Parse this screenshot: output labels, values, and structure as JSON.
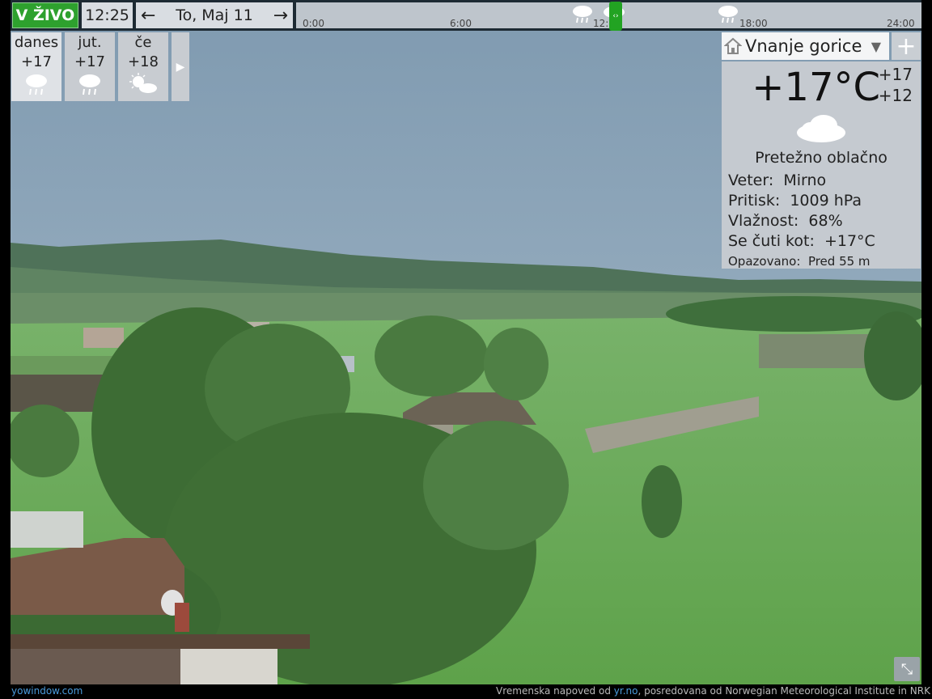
{
  "topbar": {
    "live_label": "V ŽIVO",
    "time": "12:25",
    "date": "To, Maj 11",
    "prev_icon": "arrow-left-icon",
    "next_icon": "arrow-right-icon",
    "timeline_ticks": [
      "0:00",
      "6:00",
      "12:",
      "18:00",
      "24:00"
    ],
    "timeline_position_hours": 12.4
  },
  "forecast": {
    "days": [
      {
        "name": "danes",
        "temp": "+17",
        "icon": "rain-cloud-icon"
      },
      {
        "name": "jut.",
        "temp": "+17",
        "icon": "rain-cloud-icon"
      },
      {
        "name": "če",
        "temp": "+18",
        "icon": "sun-cloud-icon"
      }
    ],
    "next_icon": "play-right-icon"
  },
  "panel": {
    "location": "Vnanje gorice",
    "temp": "+17°C",
    "high": "+17",
    "low": "+12",
    "condition": "Pretežno oblačno",
    "wind_label": "Veter:",
    "wind_value": "Mirno",
    "pressure_label": "Pritisk:",
    "pressure_value": "1009 hPa",
    "humidity_label": "Vlažnost:",
    "humidity_value": "68%",
    "feels_label": "Se čuti kot:",
    "feels_value": "+17°C",
    "observed_label": "Opazovano:",
    "observed_value": "Pred 55 m"
  },
  "footer": {
    "site": "yowindow.com",
    "credit_prefix": "Vremenska napoved od",
    "credit_link": "yr.no",
    "credit_suffix": ", posredovana od Norwegian Meteorological Institute in NRK"
  },
  "colors": {
    "live_green": "#2ea12e",
    "link_blue": "#4a9bdc",
    "sky": "#8fa8b8",
    "grass": "#6fae5a"
  }
}
